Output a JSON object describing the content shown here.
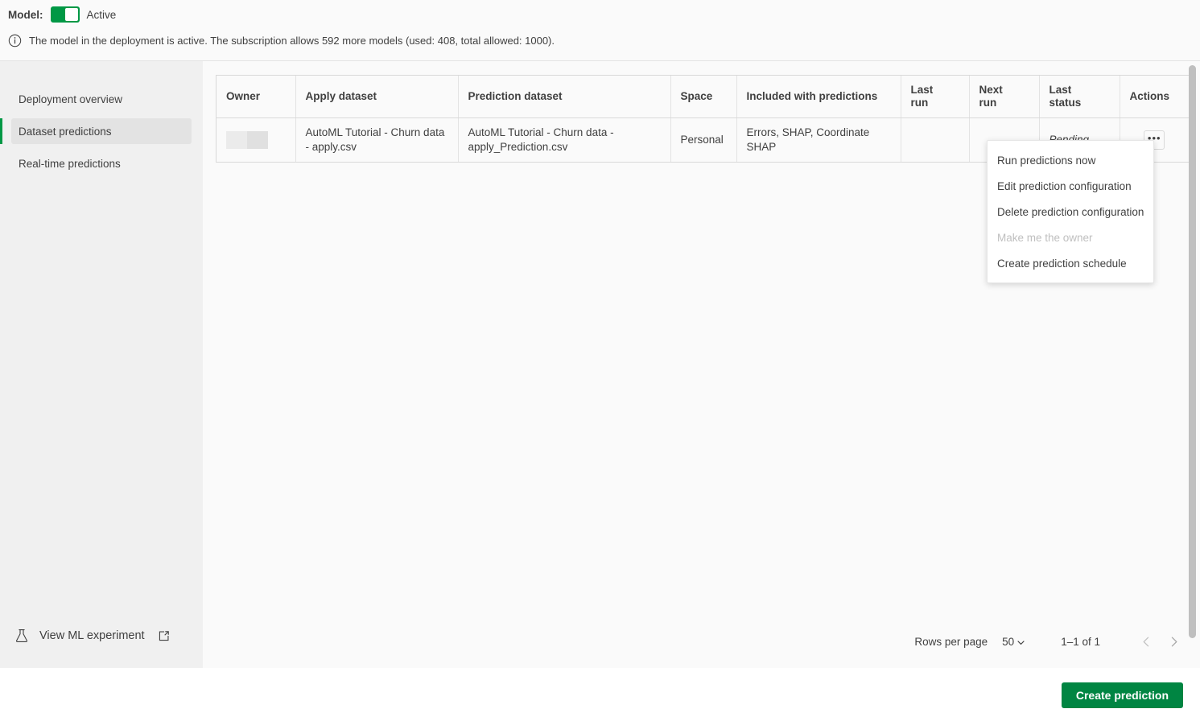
{
  "topbar": {
    "model_label": "Model:",
    "toggle_state_label": "Active",
    "toggle_on": true,
    "toggle_color": "#009845",
    "info_icon": "info-circle-icon",
    "info_text": "The model in the deployment is active. The subscription allows 592 more models (used: 408, total allowed: 1000)."
  },
  "sidebar": {
    "items": [
      {
        "label": "Deployment overview",
        "selected": false
      },
      {
        "label": "Dataset predictions",
        "selected": true
      },
      {
        "label": "Real-time predictions",
        "selected": false
      }
    ],
    "ml_link": {
      "label": "View ML experiment",
      "icon": "flask-icon",
      "external_icon": "external-link-icon"
    },
    "accent_color": "#009845"
  },
  "table": {
    "columns": [
      "Owner",
      "Apply dataset",
      "Prediction dataset",
      "Space",
      "Included with predictions",
      "Last\nrun",
      "Next\nrun",
      "Last\nstatus",
      "Actions"
    ],
    "columns_display": {
      "owner": "Owner",
      "apply_dataset": "Apply dataset",
      "prediction_dataset": "Prediction dataset",
      "space": "Space",
      "included": "Included with predictions",
      "last_run_l1": "Last",
      "last_run_l2": "run",
      "next_run_l1": "Next",
      "next_run_l2": "run",
      "last_status_l1": "Last",
      "last_status_l2": "status",
      "actions": "Actions"
    },
    "rows": [
      {
        "owner": "",
        "owner_redacted": true,
        "apply_dataset": "AutoML Tutorial - Churn data - apply.csv",
        "prediction_dataset": "AutoML Tutorial - Churn data - apply_Prediction.csv",
        "space": "Personal",
        "included": "Errors, SHAP, Coordinate SHAP",
        "last_run": "",
        "next_run": "",
        "last_status": "Pending",
        "actions_label": "•••"
      }
    ]
  },
  "context_menu": {
    "items": [
      {
        "label": "Run predictions now",
        "disabled": false
      },
      {
        "label": "Edit prediction configuration",
        "disabled": false
      },
      {
        "label": "Delete prediction configuration",
        "disabled": false
      },
      {
        "label": "Make me the owner",
        "disabled": true
      },
      {
        "label": "Create prediction schedule",
        "disabled": false
      }
    ]
  },
  "pagination": {
    "rows_per_page_label": "Rows per page",
    "rows_per_page_value": "50",
    "range_label": "1–1 of 1",
    "prev_icon": "chevron-left-icon",
    "next_icon": "chevron-right-icon"
  },
  "footer": {
    "create_button_label": "Create prediction",
    "create_button_color": "#008542"
  }
}
